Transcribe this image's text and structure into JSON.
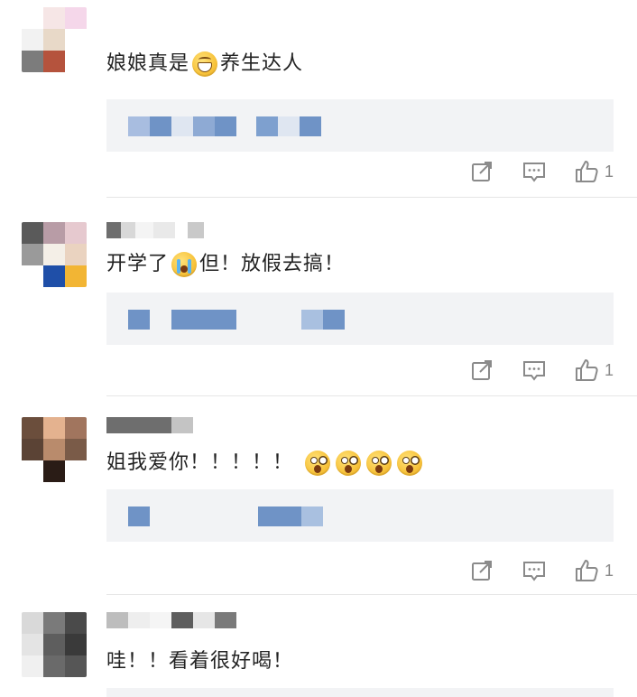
{
  "colors": {
    "text": "#222222",
    "muted": "#8a8a8a",
    "reply_bg": "#f2f3f5",
    "divider": "#e6e6e6",
    "blur_blue": "#6f93c6"
  },
  "comments": [
    {
      "text_before": "娘娘真是",
      "emoji": "grinning-emoji",
      "text_after": "养生达人",
      "likes": "1"
    },
    {
      "text_before": "开学了",
      "emoji": "crying-emoji",
      "text_after": "但！放假去搞！",
      "likes": "1"
    },
    {
      "text_before": "姐我爱你！！！！！",
      "emoji": "shocked-emoji",
      "text_after": "",
      "likes": "1"
    },
    {
      "text_before": "哇！！看着很好喝！",
      "emoji": "",
      "text_after": "",
      "likes": ""
    }
  ],
  "icons": {
    "share": "share-icon",
    "reply": "comment-icon",
    "like": "thumbs-up-icon"
  }
}
